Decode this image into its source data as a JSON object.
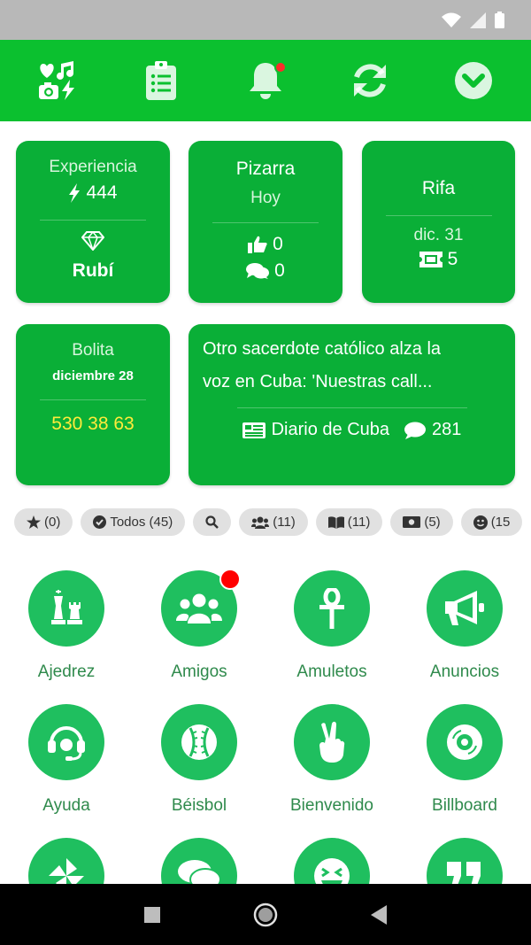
{
  "toolbar": {
    "items": [
      {
        "icon": "media-hub-icon"
      },
      {
        "icon": "clipboard-list-icon"
      },
      {
        "icon": "bell-icon",
        "has_notification": true
      },
      {
        "icon": "sync-icon"
      },
      {
        "icon": "chevron-circle-down-icon"
      }
    ]
  },
  "cards": {
    "experiencia": {
      "title": "Experiencia",
      "points": "444",
      "rank": "Rubí"
    },
    "pizarra": {
      "title": "Pizarra",
      "subtitle": "Hoy",
      "likes": "0",
      "comments": "0"
    },
    "rifa": {
      "title": "Rifa",
      "date": "dic. 31",
      "tickets": "5"
    },
    "bolita": {
      "title": "Bolita",
      "date": "diciembre 28",
      "numbers": "530 38 63"
    },
    "news": {
      "headline_line1": "Otro sacerdote católico alza la",
      "headline_line2": "voz en Cuba: 'Nuestras call...",
      "source": "Diario de Cuba",
      "comments": "281"
    }
  },
  "chips": [
    {
      "icon": "star-icon",
      "label": "(0)"
    },
    {
      "icon": "check-circle-icon",
      "label": "Todos (45)"
    },
    {
      "icon": "search-icon",
      "label": ""
    },
    {
      "icon": "users-icon",
      "label": "(11)"
    },
    {
      "icon": "book-icon",
      "label": "(11)"
    },
    {
      "icon": "money-icon",
      "label": "(5)"
    },
    {
      "icon": "smile-icon",
      "label": "(15"
    }
  ],
  "apps": [
    {
      "label": "Ajedrez",
      "icon": "chess-icon"
    },
    {
      "label": "Amigos",
      "icon": "users-icon",
      "badge": true
    },
    {
      "label": "Amuletos",
      "icon": "ankh-icon"
    },
    {
      "label": "Anuncios",
      "icon": "megaphone-icon"
    },
    {
      "label": "Ayuda",
      "icon": "headset-icon"
    },
    {
      "label": "Béisbol",
      "icon": "baseball-icon"
    },
    {
      "label": "Bienvenido",
      "icon": "peace-hand-icon"
    },
    {
      "label": "Billboard",
      "icon": "record-icon"
    },
    {
      "label": "",
      "icon": "pinwheel-icon"
    },
    {
      "label": "",
      "icon": "chat-bubbles-icon"
    },
    {
      "label": "",
      "icon": "laughing-face-icon"
    },
    {
      "label": "",
      "icon": "quote-icon"
    }
  ],
  "colors": {
    "primary_green": "#0bc02f",
    "card_green": "#0aaf37",
    "app_circle_green": "#1fbf5f",
    "label_green": "#2f8a4c",
    "lottery_yellow": "#ffeb3b",
    "notification_red": "#ff0000"
  }
}
